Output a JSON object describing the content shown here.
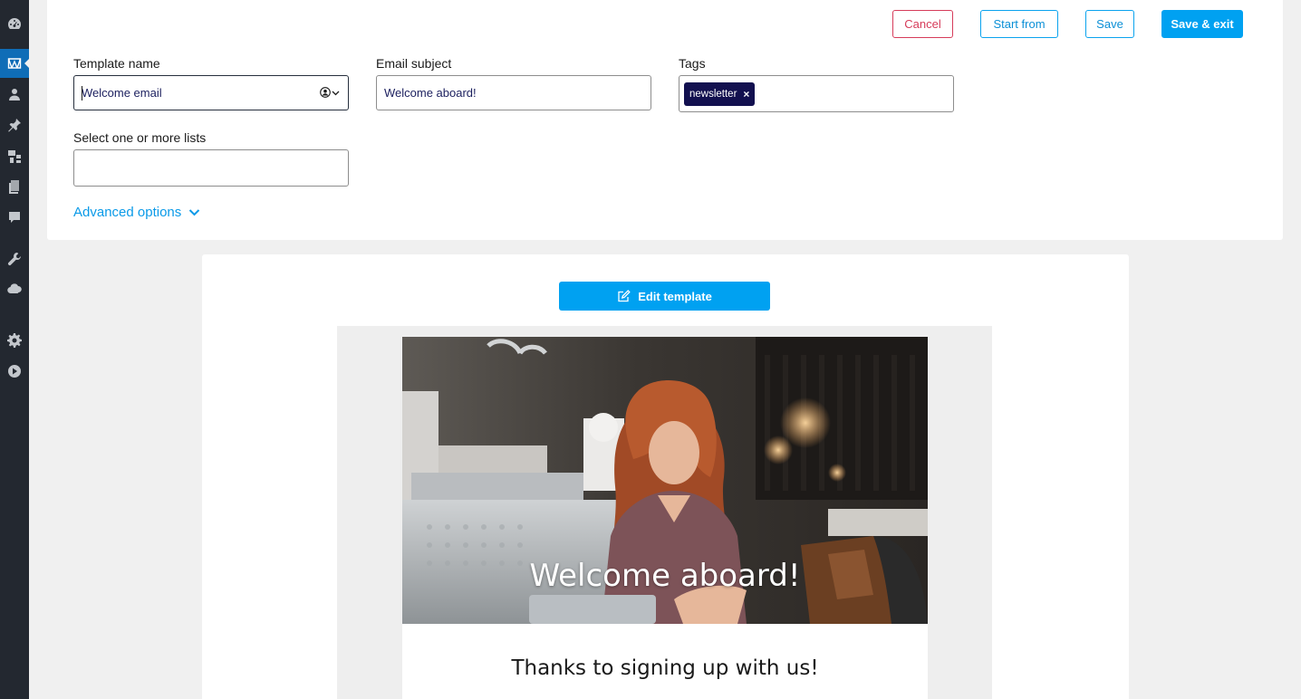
{
  "sidebar": {
    "items": [
      {
        "icon": "dashboard-icon"
      },
      {
        "icon": "emails-icon",
        "active": true
      },
      {
        "icon": "contacts-icon"
      },
      {
        "icon": "pin-icon"
      },
      {
        "icon": "assets-icon"
      },
      {
        "icon": "pages-icon"
      },
      {
        "icon": "comments-icon"
      },
      {
        "icon": "wrench-icon"
      },
      {
        "icon": "cloud-icon"
      },
      {
        "icon": "gear-icon"
      },
      {
        "icon": "play-icon"
      }
    ]
  },
  "toolbar": {
    "cancel_label": "Cancel",
    "start_from_label": "Start from",
    "save_label": "Save",
    "save_exit_label": "Save & exit"
  },
  "form": {
    "template_name": {
      "label": "Template name",
      "value": "Welcome email",
      "icon": "personalization-icon"
    },
    "email_subject": {
      "label": "Email subject",
      "value": "Welcome aboard!"
    },
    "tags": {
      "label": "Tags",
      "items": [
        "newsletter"
      ],
      "remove_glyph": "×"
    },
    "lists": {
      "label": "Select one or more lists",
      "value": ""
    },
    "advanced_options_label": "Advanced options"
  },
  "preview": {
    "edit_button_label": "Edit template",
    "hero_title": "Welcome aboard!",
    "body_text": "Thanks to signing up with us!"
  },
  "colors": {
    "sidebar_bg": "#232830",
    "accent": "#00a1f1",
    "cancel": "#d63c5a",
    "tag_bg": "#12104f"
  }
}
